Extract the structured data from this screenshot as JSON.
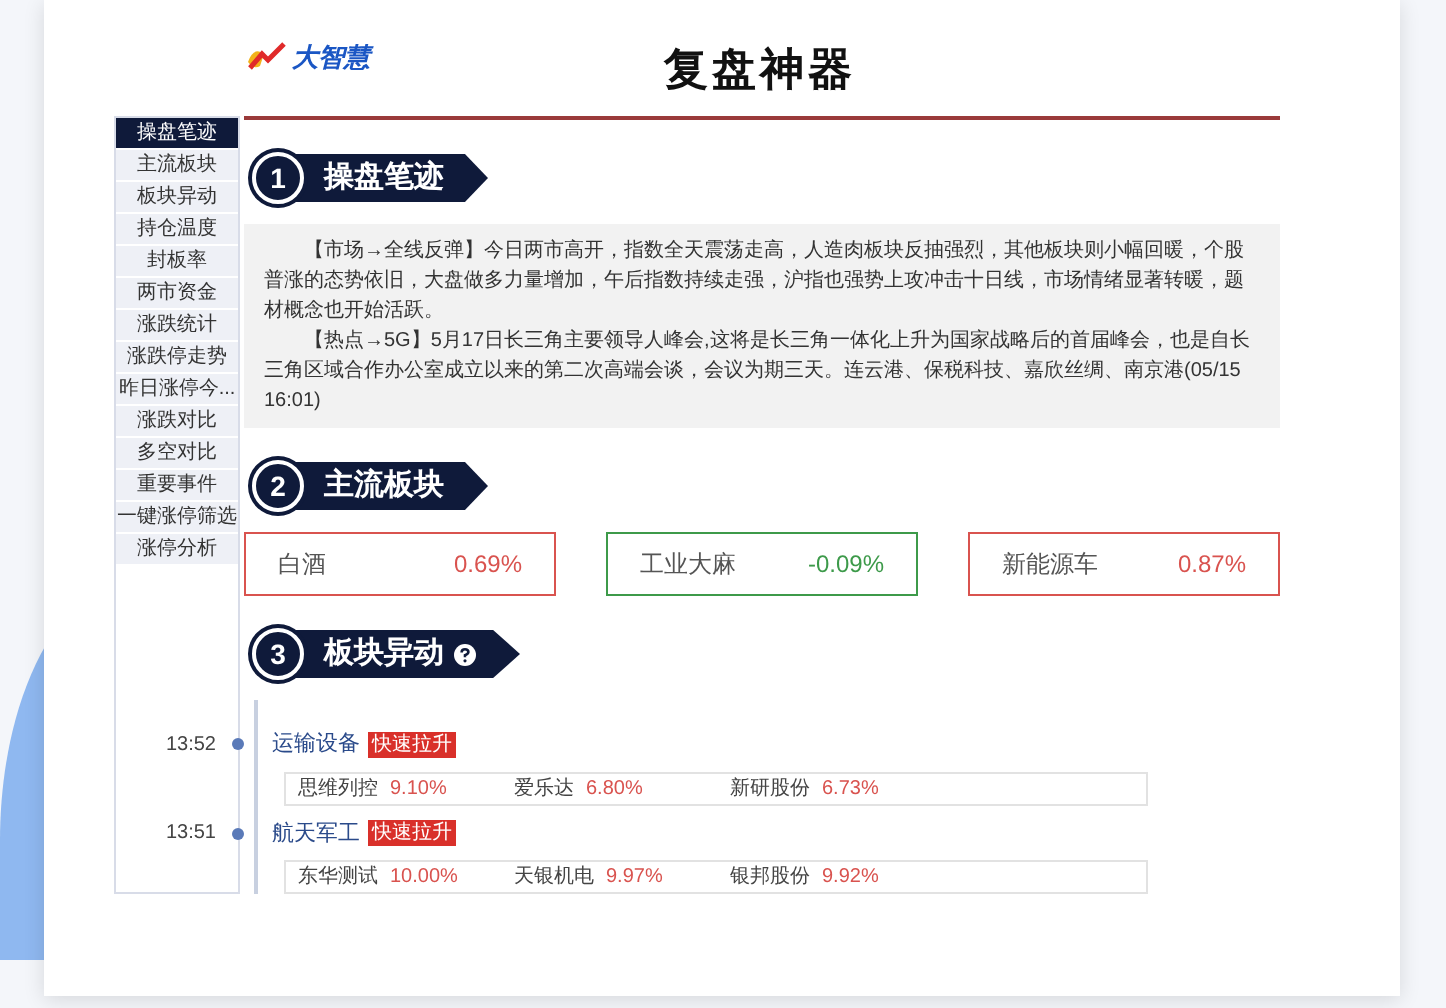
{
  "header": {
    "logo_text": "大智慧",
    "title": "复盘神器"
  },
  "sidebar": {
    "items": [
      {
        "label": "操盘笔迹",
        "selected": true
      },
      {
        "label": "主流板块",
        "selected": false
      },
      {
        "label": "板块异动",
        "selected": false
      },
      {
        "label": "持仓温度",
        "selected": false
      },
      {
        "label": "封板率",
        "selected": false
      },
      {
        "label": "两市资金",
        "selected": false
      },
      {
        "label": "涨跌统计",
        "selected": false
      },
      {
        "label": "涨跌停走势",
        "selected": false
      },
      {
        "label": "昨日涨停今...",
        "selected": false
      },
      {
        "label": "涨跌对比",
        "selected": false
      },
      {
        "label": "多空对比",
        "selected": false
      },
      {
        "label": "重要事件",
        "selected": false
      },
      {
        "label": "一键涨停筛选",
        "selected": false
      },
      {
        "label": "涨停分析",
        "selected": false
      }
    ]
  },
  "sections": [
    {
      "number": "1",
      "title": "操盘笔迹",
      "kind": "notes",
      "paragraphs": [
        "【市场→全线反弹】今日两市高开，指数全天震荡走高，人造肉板块反抽强烈，其他板块则小幅回暖，个股普涨的态势依旧，大盘做多力量增加，午后指数持续走强，沪指也强势上攻冲击十日线，市场情绪显著转暖，题材概念也开始活跃。",
        "【热点→5G】5月17日长三角主要领导人峰会,这将是长三角一体化上升为国家战略后的首届峰会，也是自长三角区域合作办公室成立以来的第二次高端会谈，会议为期三天。连云港、保税科技、嘉欣丝绸、南京港(05/15 16:01)"
      ]
    },
    {
      "number": "2",
      "title": "主流板块",
      "kind": "sectors",
      "cards": [
        {
          "name": "白酒",
          "change": "0.69%",
          "color": "#d9534f"
        },
        {
          "name": "工业大麻",
          "change": "-0.09%",
          "color": "#3d9a4a"
        },
        {
          "name": "新能源车",
          "change": "0.87%",
          "color": "#d9534f"
        }
      ]
    },
    {
      "number": "3",
      "title": "板块异动",
      "kind": "timeline",
      "help": true,
      "events": [
        {
          "time": "13:52",
          "sector": "运输设备",
          "tag": "快速拉升",
          "stocks": [
            {
              "name": "思维列控",
              "change": "9.10%"
            },
            {
              "name": "爱乐达",
              "change": "6.80%"
            },
            {
              "name": "新研股份",
              "change": "6.73%"
            }
          ]
        },
        {
          "time": "13:51",
          "sector": "航天军工",
          "tag": "快速拉升",
          "stocks": [
            {
              "name": "东华测试",
              "change": "10.00%"
            },
            {
              "name": "天银机电",
              "change": "9.97%"
            },
            {
              "name": "银邦股份",
              "change": "9.92%"
            }
          ]
        }
      ]
    }
  ]
}
